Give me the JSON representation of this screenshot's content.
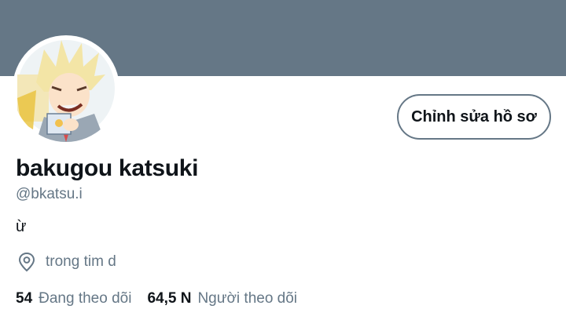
{
  "profile": {
    "edit_button_label": "Chỉnh sửa hồ sơ",
    "display_name": "bakugou katsuki",
    "handle": "@bkatsu.i",
    "bio": "ừ",
    "location": "trong tim d",
    "location_icon": "map-pin-icon"
  },
  "stats": {
    "following_count": "54",
    "following_label": "Đang theo dõi",
    "followers_count": "64,5 N",
    "followers_label": "Người theo dõi"
  },
  "colors": {
    "banner": "#657786",
    "secondary_text": "#657786",
    "primary_text": "#0f1419"
  }
}
